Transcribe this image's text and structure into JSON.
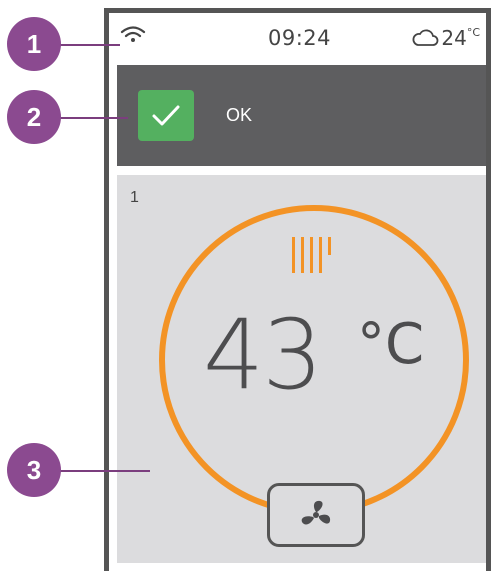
{
  "status_bar": {
    "time": "09:24",
    "weather_temp": "24",
    "weather_unit": "°C",
    "wifi_icon": "wifi-icon",
    "weather_icon": "cloud-icon"
  },
  "notification": {
    "text": "OK",
    "icon": "check-icon",
    "accent_color": "#54b060"
  },
  "zone": {
    "id": "1",
    "temperature": "43",
    "unit": "°C",
    "ring_color": "#f39325",
    "heat_icon": "radiator-heat-icon",
    "fan_icon": "fan-icon"
  },
  "callouts": [
    "1",
    "2",
    "3"
  ]
}
